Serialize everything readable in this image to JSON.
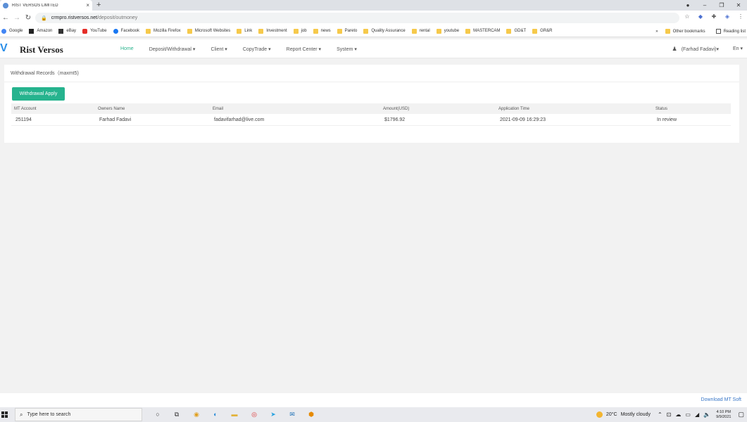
{
  "browser": {
    "tab_title": "RIST VERSOS LIMITED",
    "tab_close": "×",
    "new_tab": "+",
    "url_host": "crmpro.ristversos.net",
    "url_path": "/deposit/outmoney",
    "bookmarks": [
      "Google",
      "Amazon",
      "eBay",
      "YouTube",
      "Facebook",
      "Mozilla Firefox",
      "Microsoft Websites",
      "Link",
      "Investment",
      "job",
      "news",
      "Pareto",
      "Quality Assurance",
      "rental",
      "youtube",
      "MASTERCAM",
      "GD&T",
      "GR&R"
    ],
    "bookmarks_overflow": "»",
    "other_bookmarks": "Other bookmarks",
    "reading_list": "Reading list"
  },
  "app": {
    "brand": "Rist Versos",
    "nav": [
      {
        "label": "Home"
      },
      {
        "label": "Deposit/Withdrawal ▾"
      },
      {
        "label": "Client ▾"
      },
      {
        "label": "CopyTrade ▾"
      },
      {
        "label": "Report Center ▾"
      },
      {
        "label": "System ▾"
      }
    ],
    "user_label": "(Farhad Fadavi)▾",
    "lang_label": "En ▾"
  },
  "panel": {
    "title": "Withdrawal Records（maxmt5)",
    "apply_button": "Withdrawal Apply",
    "columns": [
      "MT Account",
      "Owners Name",
      "Email",
      "Amount(USD)",
      "Application Time",
      "Status"
    ],
    "rows": [
      [
        "251194",
        "Farhad Fadavi",
        "fadavifarhad@live.com",
        "$1796.92",
        "2021-09-09 16:29:23",
        "In review"
      ]
    ]
  },
  "footer": {
    "download_link": "Download MT Soft"
  },
  "taskbar": {
    "search_placeholder": "Type here to search",
    "weather_temp": "20°C",
    "weather_text": "Mostly cloudy",
    "time": "4:10 PM",
    "date": "9/9/2021"
  }
}
